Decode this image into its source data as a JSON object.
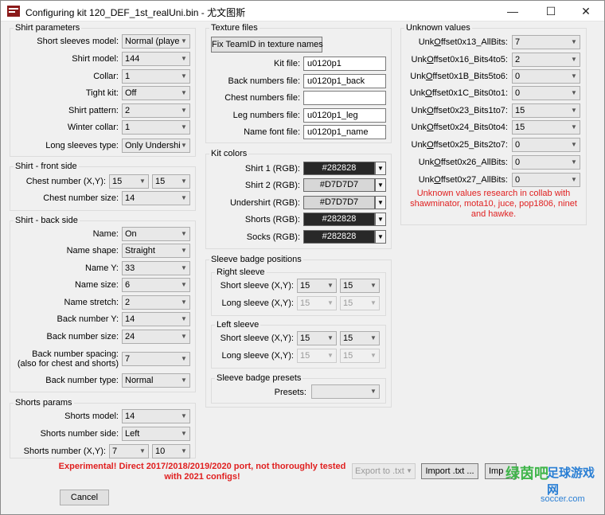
{
  "window": {
    "title": "Configuring kit 120_DEF_1st_realUni.bin - 尤文图斯",
    "min_glyph": "—",
    "max_glyph": "☐",
    "close_glyph": "✕"
  },
  "shirt_params": {
    "title": "Shirt parameters",
    "rows": [
      {
        "label": "Short sleeves model:",
        "value": "Normal (playe"
      },
      {
        "label": "Shirt model:",
        "value": "144"
      },
      {
        "label": "Collar:",
        "value": "1"
      },
      {
        "label": "Tight kit:",
        "value": "Off"
      },
      {
        "label": "Shirt pattern:",
        "value": "2"
      },
      {
        "label": "Winter collar:",
        "value": "1"
      },
      {
        "label": "Long sleeves type:",
        "value": "Only Undershi"
      }
    ]
  },
  "front_side": {
    "title": "Shirt - front side",
    "chest_number_label": "Chest number (X,Y):",
    "chest_x": "15",
    "chest_y": "15",
    "chest_size_label": "Chest number size:",
    "chest_size": "14"
  },
  "back_side": {
    "title": "Shirt - back side",
    "rows": [
      {
        "label": "Name:",
        "value": "On"
      },
      {
        "label": "Name shape:",
        "value": "Straight"
      },
      {
        "label": "Name Y:",
        "value": "33"
      },
      {
        "label": "Name size:",
        "value": "6"
      },
      {
        "label": "Name stretch:",
        "value": "2"
      },
      {
        "label": "Back number Y:",
        "value": "14"
      },
      {
        "label": "Back number size:",
        "value": "24"
      }
    ],
    "spacing_label_1": "Back number spacing:",
    "spacing_label_2": "(also for chest and shorts)",
    "spacing_value": "7",
    "type_label": "Back number type:",
    "type_value": "Normal"
  },
  "shorts": {
    "title": "Shorts params",
    "model_label": "Shorts model:",
    "model_value": "14",
    "side_label": "Shorts number side:",
    "side_value": "Left",
    "number_label": "Shorts number (X,Y):",
    "number_x": "7",
    "number_y": "10"
  },
  "texture": {
    "title": "Texture files",
    "fix_button": "Fix TeamID in texture names",
    "rows": [
      {
        "label": "Kit file:",
        "value": "u0120p1"
      },
      {
        "label": "Back numbers file:",
        "value": "u0120p1_back"
      },
      {
        "label": "Chest numbers file:",
        "value": ""
      },
      {
        "label": "Leg numbers file:",
        "value": "u0120p1_leg"
      },
      {
        "label": "Name font file:",
        "value": "u0120p1_name"
      }
    ]
  },
  "kit_colors": {
    "title": "Kit colors",
    "rows": [
      {
        "label": "Shirt 1 (RGB):",
        "value": "#282828",
        "swatch": "#282828",
        "text_color": "#ffffff"
      },
      {
        "label": "Shirt 2 (RGB):",
        "value": "#D7D7D7",
        "swatch": "#D7D7D7",
        "text_color": "#000000"
      },
      {
        "label": "Undershirt (RGB):",
        "value": "#D7D7D7",
        "swatch": "#D7D7D7",
        "text_color": "#000000"
      },
      {
        "label": "Shorts (RGB):",
        "value": "#282828",
        "swatch": "#282828",
        "text_color": "#ffffff"
      },
      {
        "label": "Socks (RGB):",
        "value": "#282828",
        "swatch": "#282828",
        "text_color": "#ffffff"
      }
    ]
  },
  "sleeve_badge": {
    "title": "Sleeve badge positions",
    "right": {
      "title": "Right sleeve",
      "short_label": "Short sleeve (X,Y):",
      "short_x": "15",
      "short_y": "15",
      "long_label": "Long sleeve (X,Y):",
      "long_x": "15",
      "long_y": "15"
    },
    "left": {
      "title": "Left sleeve",
      "short_label": "Short sleeve (X,Y):",
      "short_x": "15",
      "short_y": "15",
      "long_label": "Long sleeve (X,Y):",
      "long_x": "15",
      "long_y": "15"
    },
    "presets": {
      "title": "Sleeve badge presets",
      "label": "Presets:",
      "value": ""
    }
  },
  "unknown": {
    "title": "Unknown values",
    "rows": [
      {
        "pre": "Unk",
        "u": "O",
        "post": "ffset0x13_AllBits:",
        "value": "7"
      },
      {
        "pre": "Unk",
        "u": "O",
        "post": "ffset0x16_Bits4to5:",
        "value": "2"
      },
      {
        "pre": "Unk",
        "u": "O",
        "post": "ffset0x1B_Bits5to6:",
        "value": "0"
      },
      {
        "pre": "Unk",
        "u": "O",
        "post": "ffset0x1C_Bits0to1:",
        "value": "0"
      },
      {
        "pre": "Unk",
        "u": "O",
        "post": "ffset0x23_Bits1to7:",
        "value": "15"
      },
      {
        "pre": "Unk",
        "u": "O",
        "post": "ffset0x24_Bits0to4:",
        "value": "15"
      },
      {
        "pre": "Unk",
        "u": "O",
        "post": "ffset0x25_Bits2to7:",
        "value": "0"
      },
      {
        "pre": "Unk",
        "u": "O",
        "post": "ffset0x26_AllBits:",
        "value": "0"
      },
      {
        "pre": "Unk",
        "u": "O",
        "post": "ffset0x27_AllBits:",
        "value": "0"
      }
    ],
    "credits": "Unknown values research in collab with shawminator, mota10, juce, pop1806, ninet and hawke."
  },
  "footer": {
    "warning": "Experimental! Direct 2017/2018/2019/2020 port, not thoroughly tested with 2021 configs!",
    "export_label": "Export to .txt",
    "import_label": "Import .txt ...",
    "imp_label": "Imp",
    "cancel_label": "Cancel"
  },
  "watermark": {
    "green_text": "绿茵吧",
    "blue_text": "足球游戏网",
    "site": "soccer.com"
  },
  "colors": {
    "accent_red": "#e02020",
    "window_bg": "#f0f0f0"
  }
}
